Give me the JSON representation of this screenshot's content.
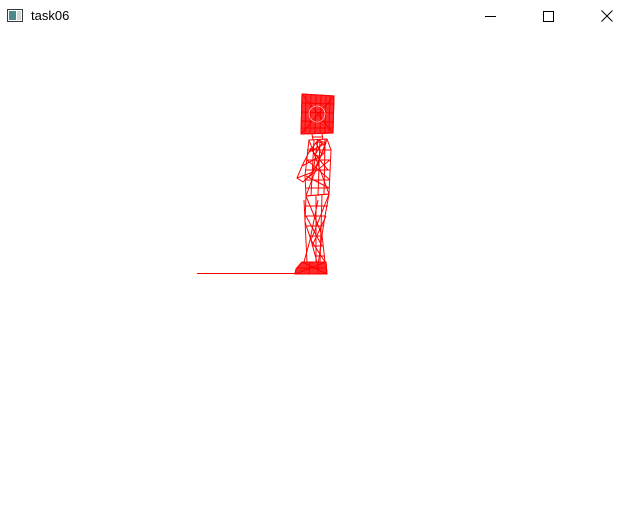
{
  "window": {
    "title": "task06",
    "app_icon": "window-app-icon",
    "controls": [
      "minimize-icon",
      "maximize-icon",
      "close-icon"
    ]
  },
  "scene": {
    "wireframe_color": "#ff0000",
    "background_color": "#ffffff",
    "content": "wireframe-humanoid-figure-with-ground-line"
  }
}
